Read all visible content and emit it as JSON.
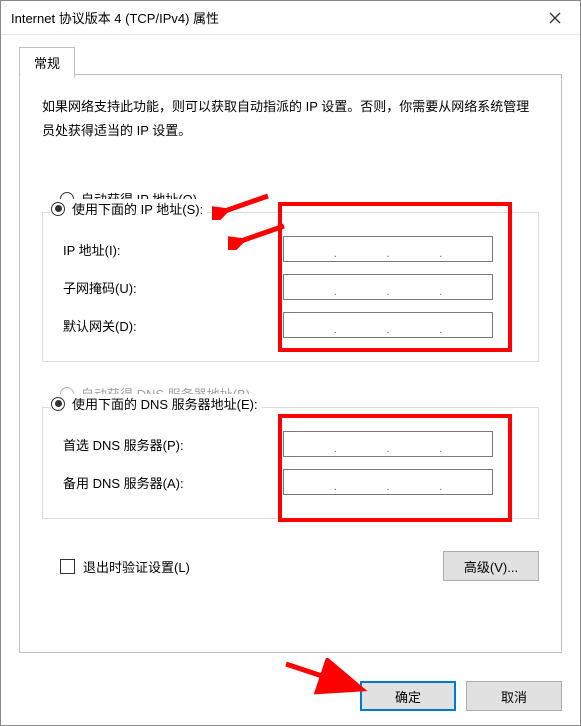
{
  "window": {
    "title": "Internet 协议版本 4 (TCP/IPv4) 属性"
  },
  "tab": {
    "general": "常规"
  },
  "description": "如果网络支持此功能，则可以获取自动指派的 IP 设置。否则，你需要从网络系统管理员处获得适当的 IP 设置。",
  "ip": {
    "auto_label": "自动获得 IP 地址(O)",
    "manual_label": "使用下面的 IP 地址(S):",
    "ip_address_label": "IP 地址(I):",
    "subnet_label": "子网掩码(U):",
    "gateway_label": "默认网关(D):",
    "ip_address_value": "",
    "subnet_value": "",
    "gateway_value": ""
  },
  "dns": {
    "auto_label": "自动获得 DNS 服务器地址(B)",
    "manual_label": "使用下面的 DNS 服务器地址(E):",
    "preferred_label": "首选 DNS 服务器(P):",
    "alternate_label": "备用 DNS 服务器(A):",
    "preferred_value": "",
    "alternate_value": ""
  },
  "validate_label": "退出时验证设置(L)",
  "buttons": {
    "advanced": "高级(V)...",
    "ok": "确定",
    "cancel": "取消"
  },
  "state": {
    "ip_selected": "manual",
    "dns_selected": "manual",
    "dns_auto_disabled": true,
    "validate_checked": false
  }
}
